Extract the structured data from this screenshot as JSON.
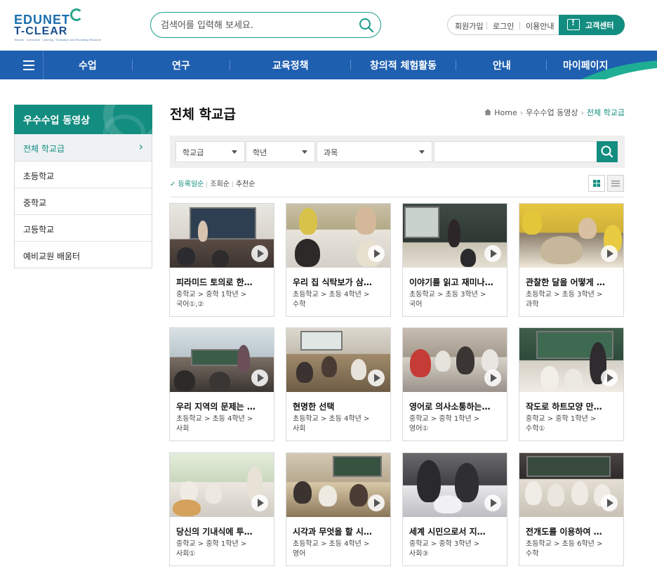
{
  "header": {
    "logo_line1": "EDUNET",
    "logo_line2": "T-CLEAR",
    "logo_tagline": "Teacher · Curriculum · Learning · Evaluation and Recording Resource",
    "search_placeholder": "검색어를 입력해 보세요.",
    "util_links": [
      "회원가입",
      "로그인",
      "이용안내"
    ],
    "customer_center": "고객센터"
  },
  "nav": {
    "items": [
      "수업",
      "연구",
      "교육정책",
      "창의적 체험활동",
      "안내",
      "마이페이지"
    ]
  },
  "sidebar": {
    "title": "우수수업 동영상",
    "items": [
      {
        "label": "전체 학교급",
        "active": true
      },
      {
        "label": "초등학교"
      },
      {
        "label": "중학교"
      },
      {
        "label": "고등학교"
      },
      {
        "label": "예비교원 배움터"
      }
    ]
  },
  "page": {
    "title": "전체 학교급",
    "breadcrumb": [
      "Home",
      "우수수업 동영상",
      "전체 학교급"
    ]
  },
  "filter": {
    "school_level": "학교급",
    "grade": "학년",
    "subject": "과목",
    "keyword": ""
  },
  "sort": {
    "options": [
      "등록일순",
      "조회순",
      "추천순"
    ],
    "selected": "등록일순"
  },
  "videos": [
    {
      "title": "피라미드 토의로 한…",
      "path": "중학교 > 중학 1학년 >",
      "subject": "국어①,②"
    },
    {
      "title": "우리 집 식탁보가 삼…",
      "path": "초등학교 > 초등 4학년 >",
      "subject": "수학"
    },
    {
      "title": "이야기를 읽고 재미나…",
      "path": "초등학교 > 초등 3학년 >",
      "subject": "국어"
    },
    {
      "title": "관찰한 달을 어떻게 …",
      "path": "초등학교 > 초등 3학년 >",
      "subject": "과학"
    },
    {
      "title": "우리 지역의 문제는 …",
      "path": "초등학교 > 초등 4학년 >",
      "subject": "사회"
    },
    {
      "title": "현명한 선택",
      "path": "초등학교 > 초등 4학년 >",
      "subject": "사회"
    },
    {
      "title": "영어로 의사소통하는…",
      "path": "중학교 > 중학 1학년 >",
      "subject": "영어①"
    },
    {
      "title": "작도로 하트모양 만…",
      "path": "중학교 > 중학 1학년 >",
      "subject": "수학①"
    },
    {
      "title": "당신의 기내식에 투…",
      "path": "중학교 > 중학 1학년 >",
      "subject": "사회①"
    },
    {
      "title": "시각과 무엇을 할 시…",
      "path": "초등학교 > 초등 4학년 >",
      "subject": "영어"
    },
    {
      "title": "세계 시민으로서 지…",
      "path": "중학교 > 중학 3학년 >",
      "subject": "사회③"
    },
    {
      "title": "전개도를 이용하여 …",
      "path": "초등학교 > 초등 6학년 >",
      "subject": "수학"
    }
  ],
  "colors": {
    "brand_teal": "#138d80",
    "nav_blue": "#1f5fb0"
  }
}
